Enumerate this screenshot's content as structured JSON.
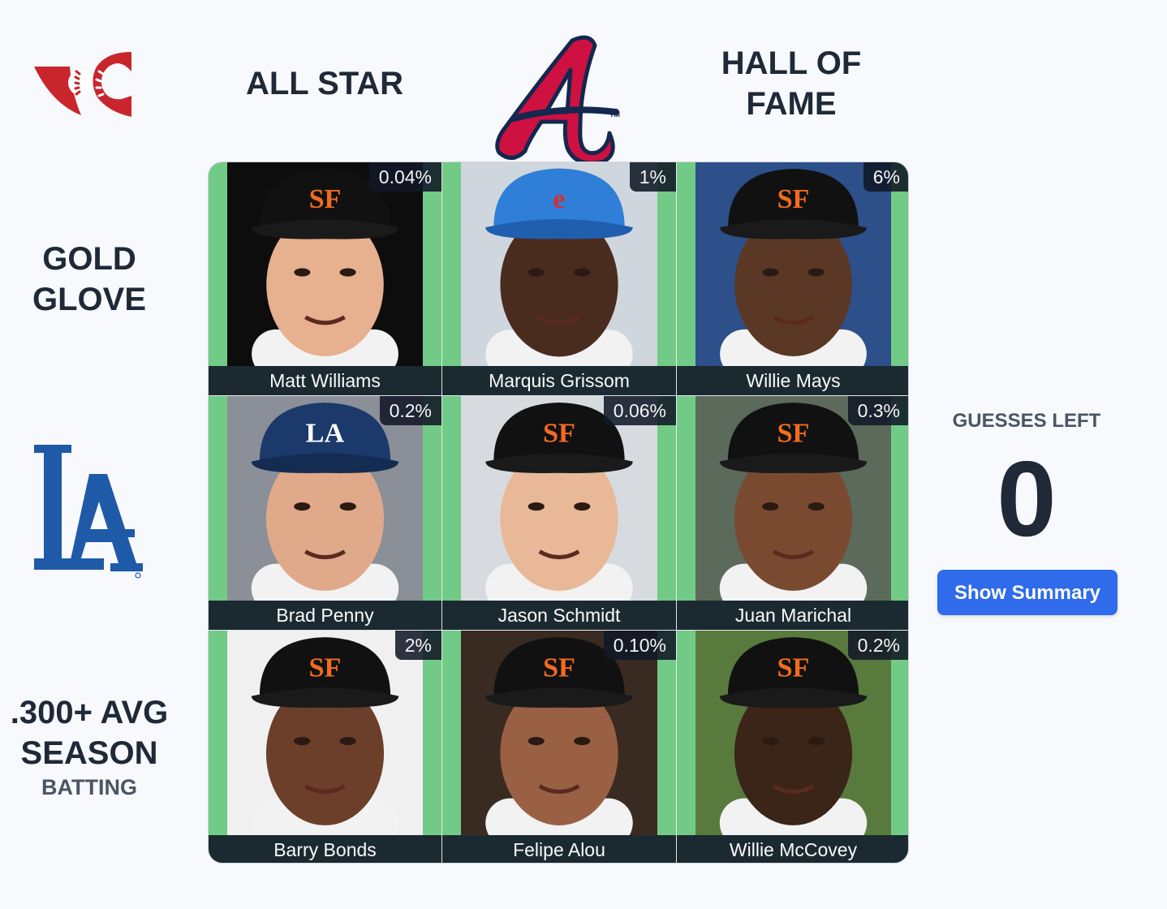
{
  "brand": {
    "logo_icon": "baseball-seams-logo-icon",
    "accent": "#c8262c"
  },
  "columns": [
    {
      "label": "ALL STAR"
    },
    {
      "label": "",
      "team_logo": "braves-a-logo-icon"
    },
    {
      "label": "HALL OF\nFAME"
    }
  ],
  "rows": [
    {
      "label": "GOLD\nGLOVE",
      "sub": ""
    },
    {
      "label": "",
      "team_logo": "dodgers-la-logo-icon"
    },
    {
      "label": ".300+ AVG\nSEASON",
      "sub": "BATTING"
    }
  ],
  "grid": [
    [
      {
        "name": "Matt Williams",
        "pct": "0.04%",
        "cap": "giants-cap"
      },
      {
        "name": "Marquis Grissom",
        "pct": "1%",
        "cap": "expos-helmet"
      },
      {
        "name": "Willie Mays",
        "pct": "6%",
        "cap": "giants-cap"
      }
    ],
    [
      {
        "name": "Brad Penny",
        "pct": "0.2%",
        "cap": "dodgers-cap"
      },
      {
        "name": "Jason Schmidt",
        "pct": "0.06%",
        "cap": "giants-cap"
      },
      {
        "name": "Juan Marichal",
        "pct": "0.3%",
        "cap": "giants-cap"
      }
    ],
    [
      {
        "name": "Barry Bonds",
        "pct": "2%",
        "cap": "giants-cap"
      },
      {
        "name": "Felipe Alou",
        "pct": "0.10%",
        "cap": "giants-cap"
      },
      {
        "name": "Willie McCovey",
        "pct": "0.2%",
        "cap": "giants-cap"
      }
    ]
  ],
  "correct_color": "#72ca87",
  "guesses": {
    "label": "GUESSES LEFT",
    "count": "0"
  },
  "summary_button": {
    "label": "Show Summary"
  }
}
